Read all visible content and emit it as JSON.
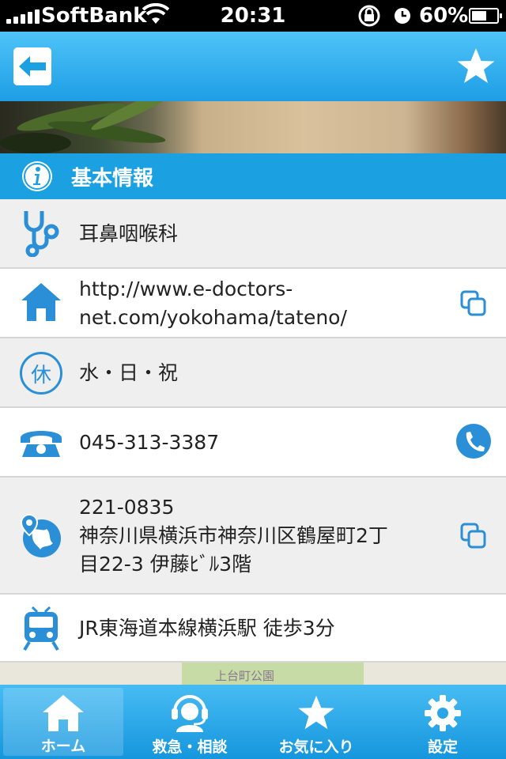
{
  "status_bar": {
    "carrier": "SoftBank",
    "time": "20:31",
    "battery_pct": "60%",
    "battery_level": 0.6
  },
  "header": {
    "back_icon": "arrow-left-icon",
    "favorite_icon": "star-icon"
  },
  "section": {
    "title": "基本情報",
    "icon": "info-icon"
  },
  "info_rows": {
    "department": {
      "icon": "stethoscope-icon",
      "text": "耳鼻咽喉科"
    },
    "website": {
      "icon": "house-icon",
      "line1": "http://www.e-doctors-",
      "line2": "net.com/yokohama/tateno/",
      "action_icon": "copy-icon"
    },
    "holidays": {
      "icon": "holiday-icon",
      "icon_glyph": "休",
      "text": "水・日・祝"
    },
    "phone": {
      "icon": "telephone-icon",
      "text": "045-313-3387",
      "action_icon": "call-icon"
    },
    "address": {
      "icon": "map-pin-globe-icon",
      "postal": "221-0835",
      "line1": "神奈川県横浜市神奈川区鶴屋町2丁",
      "line2": "目22-3 伊藤ﾋﾞﾙ3階",
      "action_icon": "copy-icon"
    },
    "access": {
      "icon": "train-icon",
      "text": "JR東海道本線横浜駅 徒歩3分"
    }
  },
  "map": {
    "label": "上台町公園"
  },
  "tabs": [
    {
      "label": "ホーム",
      "icon": "home-icon",
      "active": true
    },
    {
      "label": "救急・相談",
      "icon": "operator-icon",
      "active": false
    },
    {
      "label": "お気に入り",
      "icon": "star-icon",
      "active": false
    },
    {
      "label": "設定",
      "icon": "gear-icon",
      "active": false
    }
  ],
  "colors": {
    "accent": "#1ba0e2",
    "icon_blue": "#2a8fd6",
    "row_gray": "#efefef",
    "row_white": "#ffffff"
  }
}
